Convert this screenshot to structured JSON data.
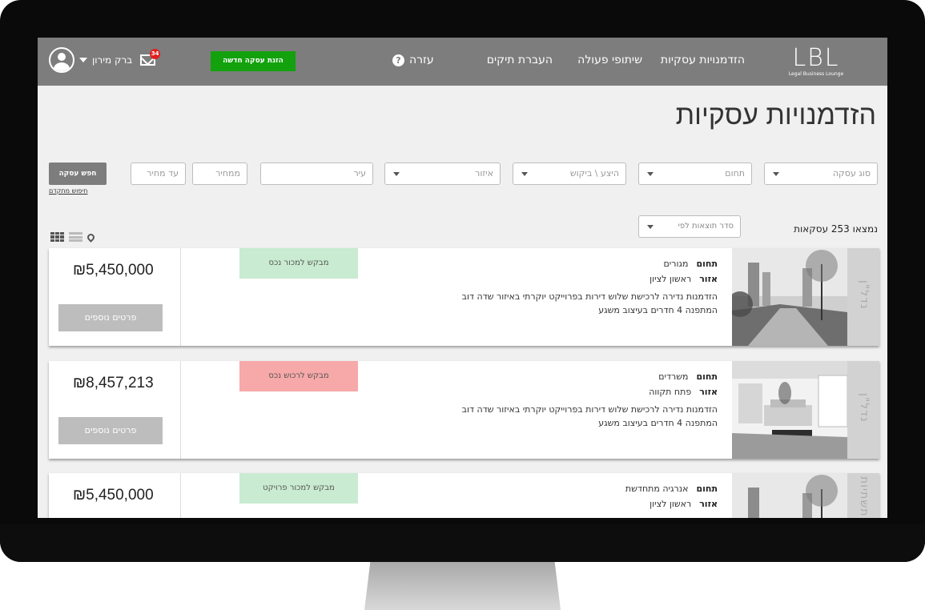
{
  "header": {
    "logo": "LBL",
    "logo_sub": "Legal Business Lounge",
    "nav": [
      "הזדמנויות עסקיות",
      "שיתופי פעולה",
      "העברת תיקים"
    ],
    "help": "עזרה",
    "new_deal_button": "הזנת עסקה חדשה",
    "user_name": "ברק מירון",
    "mail_badge": "34"
  },
  "page_title": "הזדמנויות עסקיות",
  "filters": {
    "deal_type": "סוג עסקה",
    "field": "תחום",
    "offer_demand": "היצע \\ ביקוש",
    "area": "איזור",
    "city": "עיר",
    "price_from": "ממחיר",
    "price_to": "עד מחיר",
    "search_button": "חפש עסקה",
    "advanced_search": "חיפוש מתקדם"
  },
  "results": {
    "found_text": "נמצאו 253 עסקאות",
    "sort_placeholder": "סדר תוצאות לפי"
  },
  "labels": {
    "field": "תחום",
    "area": "אזור",
    "more_details": "פרטים נוספים"
  },
  "listings": [
    {
      "side_label": "נדל\"ן",
      "field": "מגורים",
      "area": "ראשון לציון",
      "desc_line1": "הזדמנות נדירה לרכישת שלוש דירות בפרוייקט יוקרתי באיזור שדה דוב",
      "desc_line2": "המתפנה 4 חדרים בעיצוב משגע",
      "tag": "מבקש למכור נכס",
      "tag_color": "#c9ebd1",
      "price": "₪5,450,000"
    },
    {
      "side_label": "נדל\"ן",
      "field": "משרדים",
      "area": "פתח תקווה",
      "desc_line1": "הזדמנות נדירה לרכישת שלוש דירות בפרוייקט יוקרתי באיזור שדה דוב",
      "desc_line2": "המתפנה 4 חדרים בעיצוב משגע",
      "tag": "מבקש לרכוש נכס",
      "tag_color": "#f7a8a8",
      "price": "₪8,457,213"
    },
    {
      "side_label": "תשתיות",
      "field": "אנרגיה מתחדשת",
      "area": "ראשון לציון",
      "desc_line1": "",
      "desc_line2": "",
      "tag": "מבקש למכור פרויקט",
      "tag_color": "#c9ebd1",
      "price": "₪5,450,000"
    }
  ]
}
